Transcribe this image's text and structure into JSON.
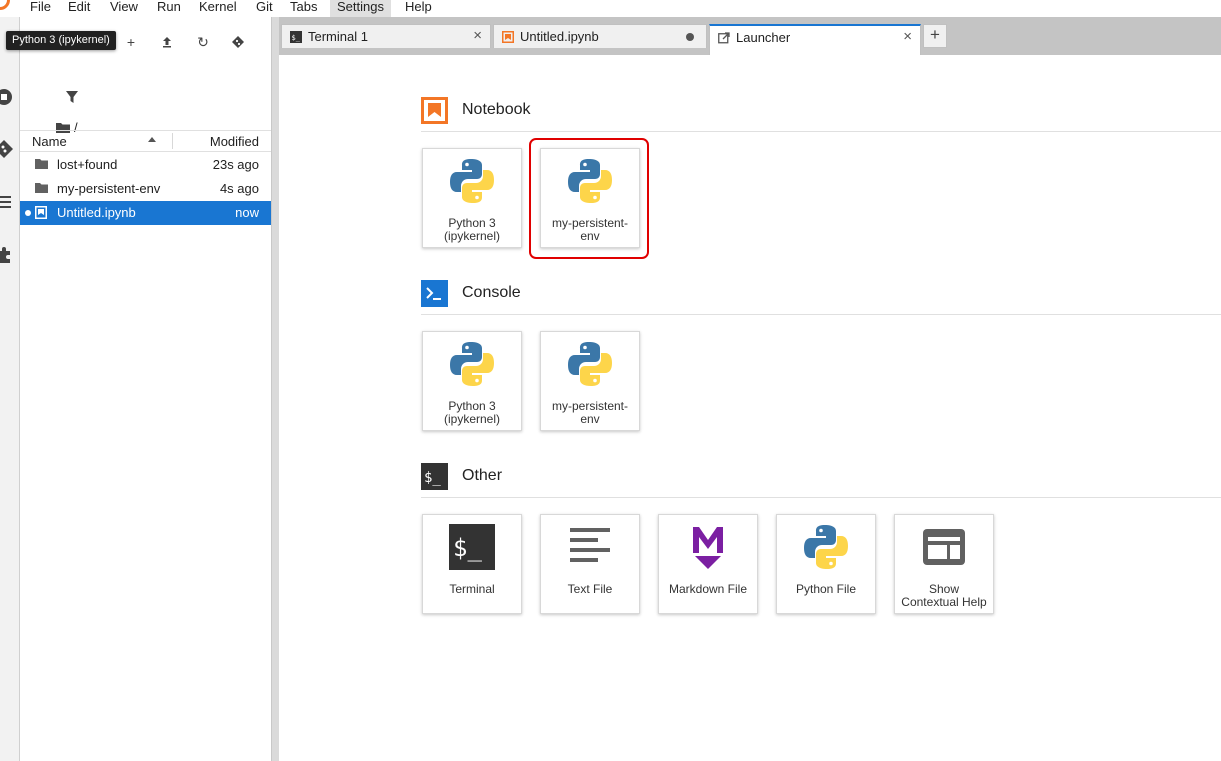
{
  "menubar": {
    "items": [
      "File",
      "Edit",
      "View",
      "Run",
      "Kernel",
      "Git",
      "Tabs",
      "Settings",
      "Help"
    ],
    "active": "Settings"
  },
  "tooltip": "Python 3 (ipykernel)",
  "filebrowser": {
    "path": "/",
    "columns": {
      "name": "Name",
      "modified": "Modified"
    },
    "rows": [
      {
        "name": "lost+found",
        "modified": "23s ago",
        "icon": "folder-icon"
      },
      {
        "name": "my-persistent-env",
        "modified": "4s ago",
        "icon": "folder-icon"
      },
      {
        "name": "Untitled.ipynb",
        "modified": "now",
        "icon": "notebook-icon",
        "selected": true
      }
    ]
  },
  "tabs": [
    {
      "label": "Terminal 1",
      "icon": "terminal-icon"
    },
    {
      "label": "Untitled.ipynb",
      "icon": "notebook-icon",
      "unsaved": true
    },
    {
      "label": "Launcher",
      "icon": "launcher-icon",
      "current": true
    }
  ],
  "launcher": {
    "notebook": {
      "title": "Notebook",
      "cards": [
        {
          "label": "Python 3 (ipykernel)"
        },
        {
          "label": "my-persistent-env"
        }
      ]
    },
    "console": {
      "title": "Console",
      "cards": [
        {
          "label": "Python 3 (ipykernel)"
        },
        {
          "label": "my-persistent-env"
        }
      ]
    },
    "other": {
      "title": "Other",
      "cards": [
        {
          "label": "Terminal",
          "icon": "terminal-icon"
        },
        {
          "label": "Text File",
          "icon": "text-file-icon"
        },
        {
          "label": "Markdown File",
          "icon": "markdown-icon"
        },
        {
          "label": "Python File",
          "icon": "python-icon"
        },
        {
          "label": "Show Contextual Help",
          "icon": "contextual-help-icon"
        }
      ]
    }
  },
  "colors": {
    "accent": "#1976d2",
    "notebook_orange": "#f37626",
    "highlight_red": "#e00000",
    "markdown_purple": "#7b1fa2"
  }
}
